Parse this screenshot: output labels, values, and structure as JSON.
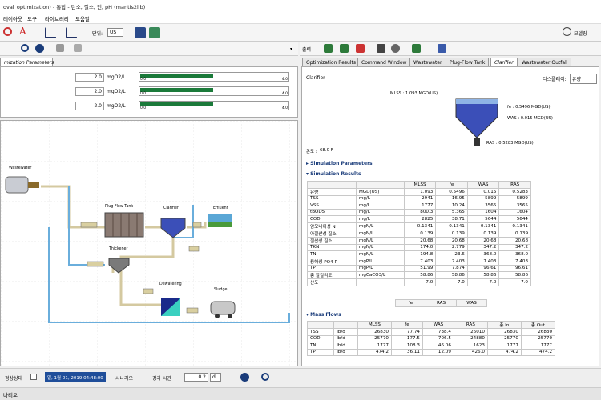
{
  "window_title": "oval_optimization) - 통합 - 탄소, 질소, 인, pH (mantis2lib)",
  "menu": [
    "레이아웃",
    "도구",
    "라이브러리",
    "도움말"
  ],
  "toolbar": {
    "unit_label": "단위:",
    "unit_value": "US",
    "model_label": "모델링"
  },
  "left_tab": "mization Parameters",
  "gauges": [
    {
      "value": "2.0",
      "unit": "mgO2/L",
      "min": "0.0",
      "max": "4.0",
      "fraction": 0.5
    },
    {
      "value": "2.0",
      "unit": "mgO2/L",
      "min": "0.0",
      "max": "4.0",
      "fraction": 0.5
    },
    {
      "value": "2.0",
      "unit": "mgO2/L",
      "min": "0.0",
      "max": "4.0",
      "fraction": 0.5
    }
  ],
  "flowsheet": {
    "wastewater": "Wastewater",
    "plug_flow_tank": "Plug Flow Tank",
    "clarifier": "Clarifier",
    "effluent": "Effluent",
    "thickener": "Thickener",
    "dewatering": "Dewatering",
    "sludge": "Sludge"
  },
  "right_toolbar": {
    "output_label": "출력"
  },
  "right_tabs": [
    "Optimization Results",
    "Command Window",
    "Wastewater",
    "Plug-Flow Tank",
    "Clarifier",
    "Wastewater Outfall"
  ],
  "clarifier_panel": {
    "title": "Clarifier",
    "display_label": "디스플레이:",
    "display_value": "유량",
    "mlss_label": "MLSS : 1.093 MGD(US)",
    "fe_label": "fe : 0.5496 MGD(US)",
    "was_label": "WAS : 0.015 MGD(US)",
    "ras_label": "RAS : 0.5283 MGD(US)",
    "temp_label": "온도 :",
    "temp_value": "68.0 F"
  },
  "sections": {
    "sim_params": "Simulation Parameters",
    "sim_results": "Simulation Results",
    "mass_flows": "Mass Flows"
  },
  "results_table": {
    "headers": [
      "",
      "",
      "MLSS",
      "fe",
      "WAS",
      "RAS"
    ],
    "rows": [
      [
        "유량",
        "MGD(US)",
        "1.093",
        "0.5496",
        "0.015",
        "0.5283"
      ],
      [
        "TSS",
        "mg/L",
        "2941",
        "16.95",
        "5899",
        "5899"
      ],
      [
        "VSS",
        "mg/L",
        "1777",
        "10.24",
        "3565",
        "3565"
      ],
      [
        "tBOD5",
        "mg/L",
        "800.3",
        "5.365",
        "1604",
        "1604"
      ],
      [
        "COD",
        "mg/L",
        "2825",
        "38.71",
        "5644",
        "5644"
      ],
      [
        "암모니아성 N",
        "mgN/L",
        "0.1341",
        "0.1341",
        "0.1341",
        "0.1341"
      ],
      [
        "아질산성 질소",
        "mgN/L",
        "0.139",
        "0.139",
        "0.139",
        "0.139"
      ],
      [
        "질산성 질소",
        "mgN/L",
        "20.68",
        "20.68",
        "20.68",
        "20.68"
      ],
      [
        "TKN",
        "mgN/L",
        "174.0",
        "2.779",
        "347.2",
        "347.2"
      ],
      [
        "TN",
        "mgN/L",
        "194.8",
        "23.6",
        "368.0",
        "368.0"
      ],
      [
        "용해성 PO4-P",
        "mgP/L",
        "7.403",
        "7.403",
        "7.403",
        "7.403"
      ],
      [
        "TP",
        "mgP/L",
        "51.99",
        "7.874",
        "96.61",
        "96.61"
      ],
      [
        "총 알칼리도",
        "mgCaCO3/L",
        "58.86",
        "58.86",
        "58.86",
        "58.86"
      ],
      [
        "산도",
        "-",
        "7.0",
        "7.0",
        "7.0",
        "7.0"
      ]
    ]
  },
  "sub_headers": [
    "fe",
    "RAS",
    "WAS"
  ],
  "mass_table": {
    "headers": [
      "",
      "",
      "MLSS",
      "fe",
      "WAS",
      "RAS",
      "총 In",
      "총 Out"
    ],
    "rows": [
      [
        "TSS",
        "lb/d",
        "26830",
        "77.74",
        "738.4",
        "26010",
        "26830",
        "26830"
      ],
      [
        "COD",
        "lb/d",
        "25770",
        "177.5",
        "706.5",
        "24880",
        "25770",
        "25770"
      ],
      [
        "TN",
        "lb/d",
        "1777",
        "108.3",
        "46.06",
        "1623",
        "1777",
        "1777"
      ],
      [
        "TP",
        "lb/d",
        "474.2",
        "36.11",
        "12.09",
        "426.0",
        "474.2",
        "474.2"
      ]
    ]
  },
  "status": {
    "steady_label": "정상상태",
    "date_value": "일, 1월 01, 2019 04:48:00",
    "scenario_label": "시나리오",
    "elapsed_label": "경과 시간",
    "elapsed_value": "0.2",
    "elapsed_unit": "d"
  },
  "bottom_label": "나리오",
  "colors": {
    "gauge_fill": "#1b7a3a",
    "accent_blue": "#1a3c7a",
    "date_bg": "#1f4e9a"
  }
}
